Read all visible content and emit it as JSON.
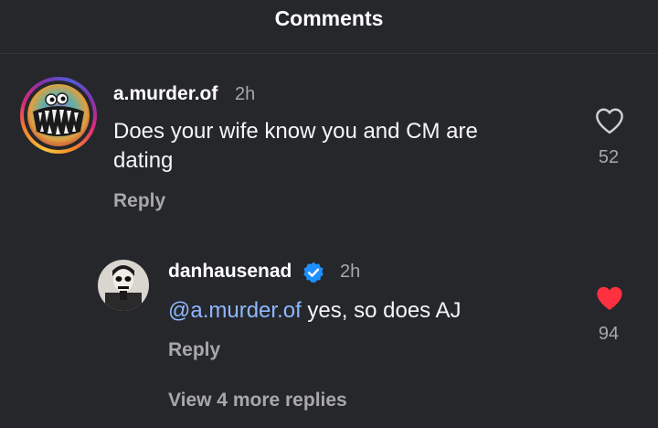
{
  "header": {
    "title": "Comments"
  },
  "comments": [
    {
      "username": "a.murder.of",
      "time": "2h",
      "text": "Does your wife know you and CM are dating",
      "reply_label": "Reply",
      "likes": "52",
      "liked": false,
      "avatar_icon": "monster-avatar"
    }
  ],
  "replies": [
    {
      "username": "danhausenad",
      "verified": true,
      "time": "2h",
      "mention": "@a.murder.of",
      "text": " yes, so does AJ",
      "reply_label": "Reply",
      "likes": "94",
      "liked": true,
      "avatar_icon": "face-paint-avatar"
    }
  ],
  "view_more_label": "View 4 more replies",
  "colors": {
    "background": "#25272b",
    "mention": "#8fb7ff",
    "like_active": "#ff3040",
    "verified_badge": "#1e90ff"
  }
}
